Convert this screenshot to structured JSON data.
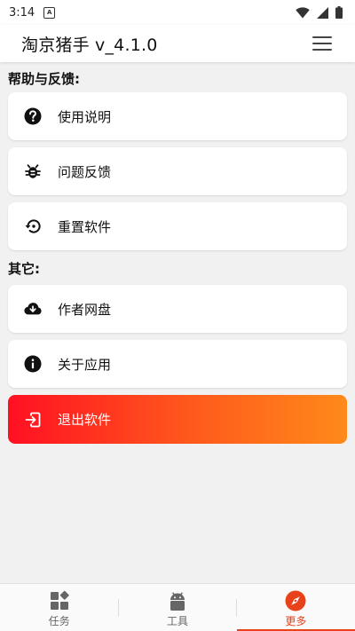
{
  "status_bar": {
    "time": "3:14",
    "notification_icon_letter": "A"
  },
  "app_bar": {
    "title": "淘京猪手 v_4.1.0"
  },
  "sections": {
    "help": {
      "title": "帮助与反馈:",
      "items": [
        {
          "label": "使用说明",
          "icon": "help-circle-icon"
        },
        {
          "label": "问题反馈",
          "icon": "bug-icon"
        },
        {
          "label": "重置软件",
          "icon": "restore-icon"
        }
      ]
    },
    "other": {
      "title": "其它:",
      "items": [
        {
          "label": "作者网盘",
          "icon": "cloud-download-icon"
        },
        {
          "label": "关于应用",
          "icon": "info-icon"
        }
      ]
    }
  },
  "exit_button": {
    "label": "退出软件",
    "icon": "exit-icon"
  },
  "bottom_nav": {
    "items": [
      {
        "label": "任务",
        "icon": "widgets-icon",
        "active": false
      },
      {
        "label": "工具",
        "icon": "android-icon",
        "active": false
      },
      {
        "label": "更多",
        "icon": "compass-icon",
        "active": true
      }
    ]
  },
  "colors": {
    "accent": "#e8421b",
    "exit_gradient_start": "#ff1022",
    "exit_gradient_end": "#ff8a1a"
  }
}
